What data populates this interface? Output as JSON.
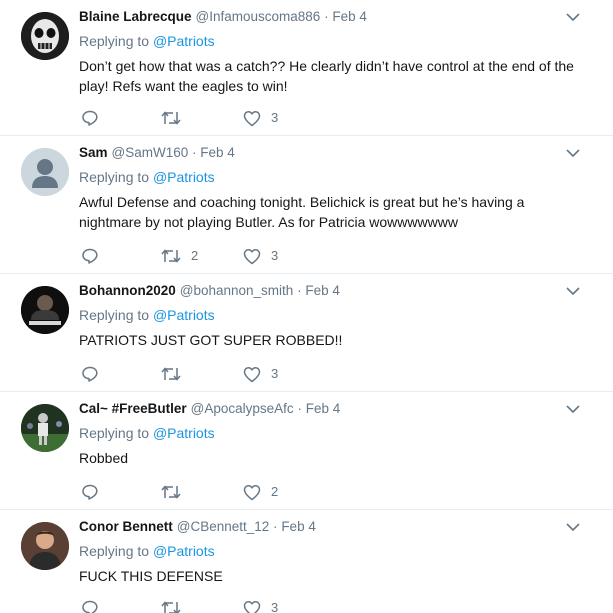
{
  "replying_prefix": "Replying to",
  "tweets": [
    {
      "name": "Blaine Labrecque",
      "handle": "@Infamouscoma886",
      "separator": "·",
      "date": "Feb 4",
      "reply_to": "@Patriots",
      "text": "Don’t get how that was a catch?? He clearly didn’t have control at the end of the play! Refs want the eagles to win!",
      "retweets": "",
      "likes": "3"
    },
    {
      "name": "Sam",
      "handle": "@SamW160",
      "separator": "·",
      "date": "Feb 4",
      "reply_to": "@Patriots",
      "text": "Awful Defense and coaching tonight. Belichick is great but he’s having a nightmare by not playing Butler. As for Patricia wowwwwwww",
      "retweets": "2",
      "likes": "3"
    },
    {
      "name": "Bohannon2020",
      "handle": "@bohannon_smith",
      "separator": "·",
      "date": "Feb 4",
      "reply_to": "@Patriots",
      "text": "PATRIOTS JUST GOT SUPER ROBBED!!",
      "retweets": "",
      "likes": "3"
    },
    {
      "name": "Cal~ #FreeButler",
      "handle": "@ApocalypseAfc",
      "separator": "·",
      "date": "Feb 4",
      "reply_to": "@Patriots",
      "text": "Robbed",
      "retweets": "",
      "likes": "2"
    },
    {
      "name": "Conor Bennett",
      "handle": "@CBennett_12",
      "separator": "·",
      "date": "Feb 4",
      "reply_to": "@Patriots",
      "text": "FUCK THIS DEFENSE",
      "retweets": "",
      "likes": "3"
    }
  ],
  "icons": {
    "reply": "reply-icon",
    "retweet": "retweet-icon",
    "like": "heart-icon",
    "more": "chevron-down-icon"
  },
  "colors": {
    "link": "#1b95e0",
    "muted": "#657786",
    "text": "#14171a",
    "divider": "#e6ecf0"
  }
}
